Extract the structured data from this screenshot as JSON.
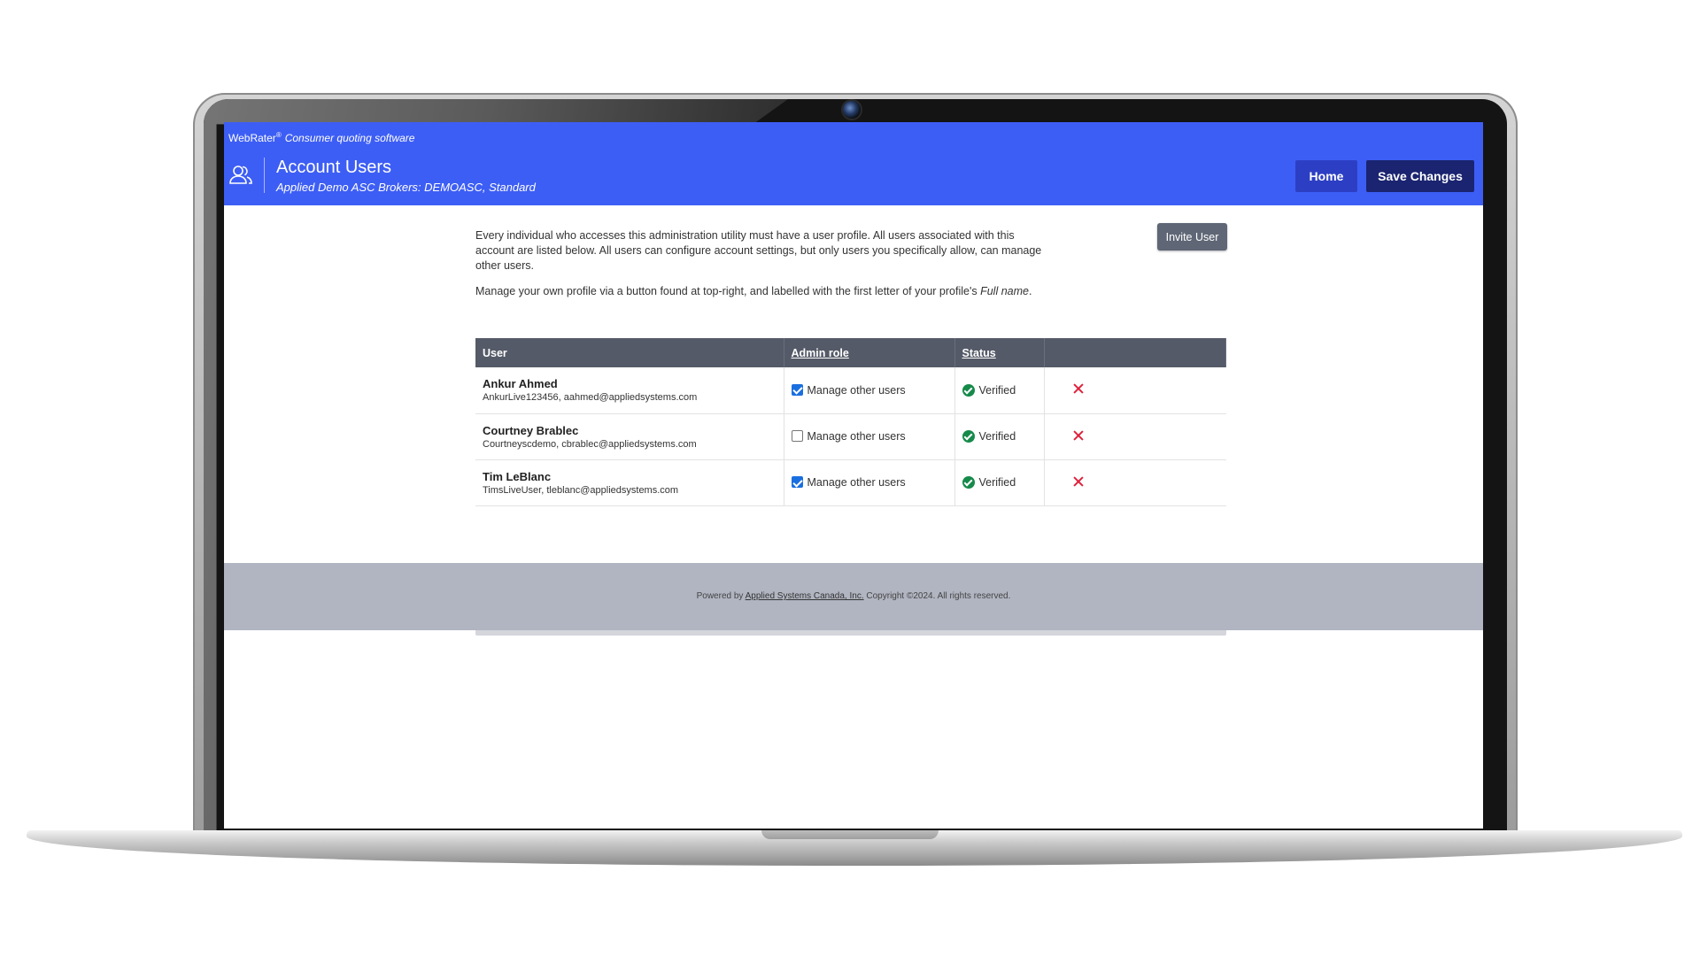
{
  "app": {
    "brand": "WebRater",
    "brand_mark": "®",
    "tagline": "Consumer quoting software",
    "title": "Account Users",
    "subtitle": "Applied Demo ASC Brokers: DEMOASC, Standard"
  },
  "header_buttons": {
    "home": "Home",
    "save": "Save Changes"
  },
  "intro": {
    "p1": "Every individual who accesses this administration utility must have a user profile. All users associated with this account are listed below. All users can configure account settings, but only users you specifically allow, can manage other users.",
    "p2_prefix": "Manage your own profile via a button found at top-right, and labelled with the first letter of your profile's ",
    "p2_em": "Full name",
    "p2_suffix": "."
  },
  "invite_button": "Invite User",
  "table": {
    "columns": [
      "User",
      "Admin role",
      "Status",
      ""
    ],
    "rows": [
      {
        "name": "Ankur Ahmed",
        "sub": "AnkurLive123456, aahmed@appliedsystems.com",
        "role": "Manage other users",
        "role_checked": true,
        "status": "Verified"
      },
      {
        "name": "Courtney Brablec",
        "sub": "Courtneyscdemo, cbrablec@appliedsystems.com",
        "role": "Manage other users",
        "role_checked": false,
        "status": "Verified"
      },
      {
        "name": "Tim LeBlanc",
        "sub": "TimsLiveUser, tleblanc@appliedsystems.com",
        "role": "Manage other users",
        "role_checked": true,
        "status": "Verified"
      }
    ]
  },
  "footer": {
    "prefix": "Powered by ",
    "link": "Applied Systems Canada, Inc.",
    "suffix": " Copyright ©2024. All rights reserved."
  },
  "colors": {
    "header": "#3d5ef5",
    "home_button": "#2c3fc4",
    "save_button": "#1a2470",
    "table_header": "#555a68",
    "footer": "#b1b5c1",
    "verified": "#168a4a",
    "remove": "#e0203a"
  },
  "icons": {
    "header": "users-icon",
    "status": "check-circle-icon",
    "remove": "x-icon"
  }
}
